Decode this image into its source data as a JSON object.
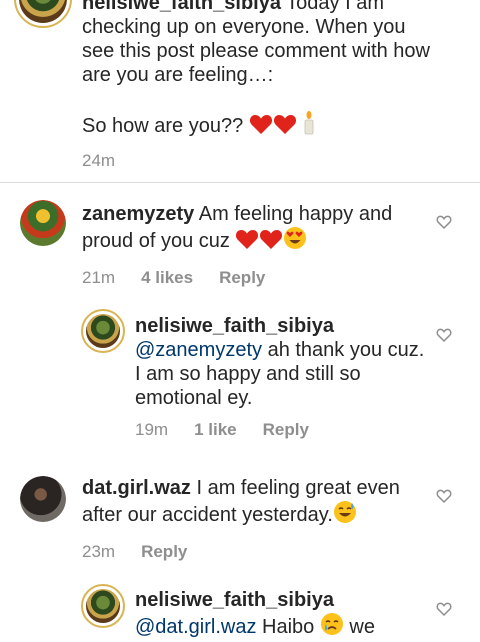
{
  "post_caption": {
    "username": "nelisiwe_faith_sibiya",
    "text_part1": " Today I am checking up on everyone. When you see this post please comment with how are you are feeling…:",
    "text_part2": "So how are you??",
    "time": "24m"
  },
  "comments": [
    {
      "username": "zanemyzety",
      "text": " Am feeling happy and proud of you cuz",
      "time": "21m",
      "likes": "4 likes",
      "reply": "Reply",
      "emojis": [
        "red-heart",
        "red-heart",
        "heart-eyes"
      ]
    },
    {
      "username": "nelisiwe_faith_sibiya",
      "mention": "@zanemyzety",
      "text": " ah thank you cuz. I am so happy and still so emotional ey.",
      "time": "19m",
      "likes": "1 like",
      "reply": "Reply"
    },
    {
      "username": "dat.girl.waz",
      "text": " I am feeling great even after our accident yesterday.",
      "time": "23m",
      "reply": "Reply",
      "emojis": [
        "sweat-smile"
      ]
    },
    {
      "username": "nelisiwe_faith_sibiya",
      "mention": "@dat.girl.waz",
      "text": " Haibo",
      "text_after": " we"
    }
  ],
  "colors": {
    "text": "#262626",
    "meta": "#8e8e8e",
    "mention": "#00376b",
    "divider": "#dbdbdb",
    "heart": "#e0241b",
    "ring": "#d8b453"
  }
}
